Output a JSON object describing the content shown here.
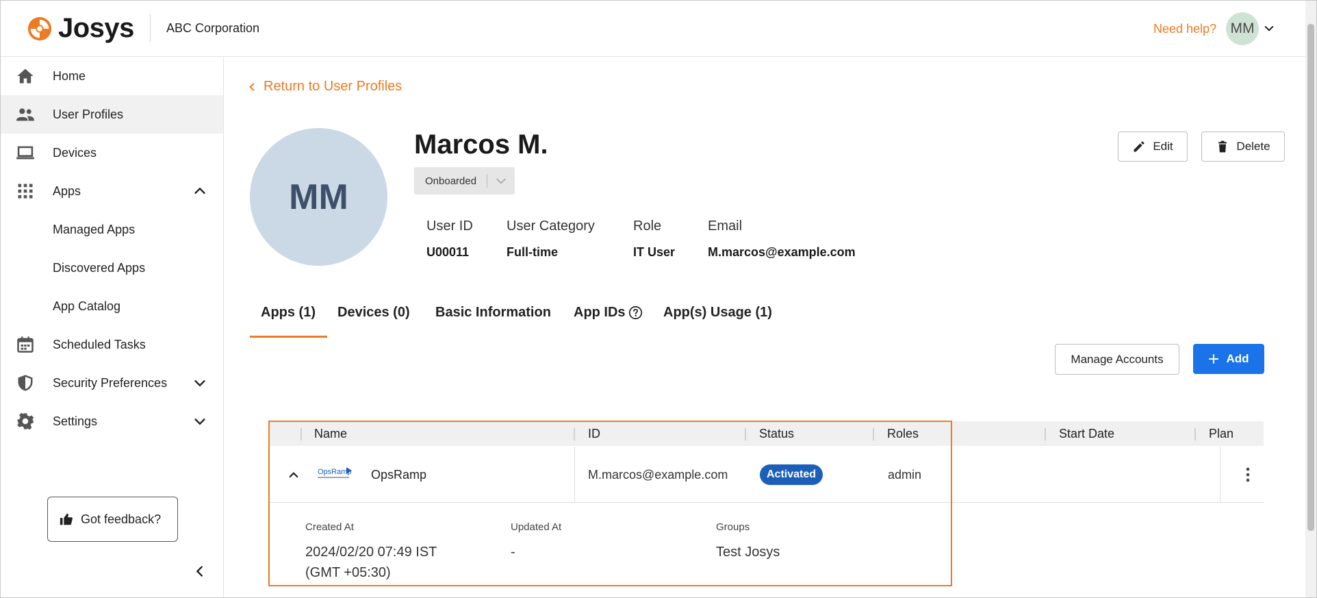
{
  "header": {
    "logo_text": "Josys",
    "org_name": "ABC Corporation",
    "help_link": "Need help?",
    "user_initials": "MM",
    "brand_color": "#ee7a22"
  },
  "sidebar": {
    "items": [
      {
        "label": "Home",
        "icon": "home-icon"
      },
      {
        "label": "User Profiles",
        "icon": "people-icon"
      },
      {
        "label": "Devices",
        "icon": "laptop-icon"
      },
      {
        "label": "Apps",
        "icon": "grid-icon"
      },
      {
        "label": "Managed Apps"
      },
      {
        "label": "Discovered Apps"
      },
      {
        "label": "App Catalog"
      },
      {
        "label": "Scheduled Tasks",
        "icon": "calendar-icon"
      },
      {
        "label": "Security Preferences",
        "icon": "shield-icon"
      },
      {
        "label": "Settings",
        "icon": "gear-icon"
      }
    ],
    "feedback_label": "Got feedback?"
  },
  "main": {
    "back_link": "Return to User Profiles",
    "user": {
      "initials": "MM",
      "name": "Marcos M.",
      "status": "Onboarded",
      "fields": [
        {
          "label": "User ID",
          "value": "U00011"
        },
        {
          "label": "User Category",
          "value": "Full-time"
        },
        {
          "label": "Role",
          "value": "IT User"
        },
        {
          "label": "Email",
          "value": "M.marcos@example.com"
        }
      ]
    },
    "actions": {
      "edit": "Edit",
      "delete": "Delete",
      "manage_accounts": "Manage Accounts",
      "add": "Add"
    },
    "tabs": [
      {
        "label": "Apps (1)",
        "active": true
      },
      {
        "label": "Devices (0)"
      },
      {
        "label": "Basic Information"
      },
      {
        "label": "App IDs"
      },
      {
        "label": "App(s) Usage (1)"
      }
    ],
    "table": {
      "columns": [
        "Name",
        "ID",
        "Status",
        "Roles",
        "Start Date",
        "Plan"
      ],
      "rows": [
        {
          "logo": "OpsRamp",
          "name": "OpsRamp",
          "id": "M.marcos@example.com",
          "status": "Activated",
          "roles": "admin",
          "start_date": "",
          "plan": ""
        }
      ],
      "details": {
        "created_at_label": "Created At",
        "created_at": "2024/02/20 07:49 IST",
        "created_at_tz": "(GMT +05:30)",
        "updated_at_label": "Updated At",
        "updated_at": "-",
        "groups_label": "Groups",
        "groups": "Test Josys"
      }
    }
  }
}
